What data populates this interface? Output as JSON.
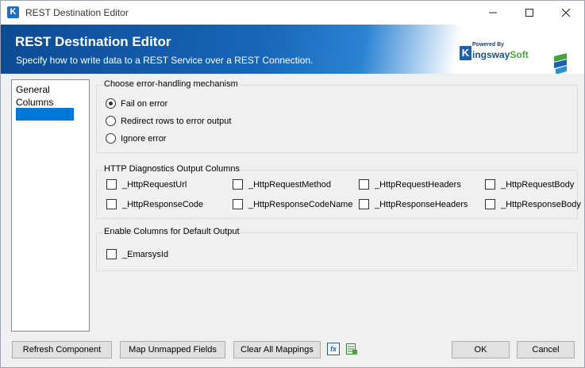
{
  "window": {
    "title": "REST Destination Editor",
    "app_icon_glyph": "K",
    "controls": [
      "minimize-icon",
      "maximize-icon",
      "close-icon"
    ]
  },
  "banner": {
    "title": "REST Destination Editor",
    "subtitle": "Specify how to write data to a REST Service over a REST Connection.",
    "brand_powered": "Powered By",
    "brand_k": "K",
    "brand_name": "ingsway",
    "brand_soft": "Soft"
  },
  "nav": {
    "items": [
      {
        "label": "General",
        "selected": false
      },
      {
        "label": "Columns",
        "selected": false
      },
      {
        "label": "",
        "selected": true
      }
    ]
  },
  "error_handling": {
    "label": "Choose error-handling mechanism",
    "options": [
      {
        "label": "Fail on error",
        "selected": true
      },
      {
        "label": "Redirect rows to error output",
        "selected": false
      },
      {
        "label": "Ignore error",
        "selected": false
      }
    ]
  },
  "diagnostics": {
    "label": "HTTP Diagnostics Output Columns",
    "columns": [
      {
        "label": "_HttpRequestUrl",
        "checked": false
      },
      {
        "label": "_HttpRequestMethod",
        "checked": false
      },
      {
        "label": "_HttpRequestHeaders",
        "checked": false
      },
      {
        "label": "_HttpRequestBody",
        "checked": false
      },
      {
        "label": "_HttpResponseCode",
        "checked": false
      },
      {
        "label": "_HttpResponseCodeName",
        "checked": false
      },
      {
        "label": "_HttpResponseHeaders",
        "checked": false
      },
      {
        "label": "_HttpResponseBody",
        "checked": false
      }
    ]
  },
  "default_output": {
    "label": "Enable Columns for Default Output",
    "columns": [
      {
        "label": "_EmarsysId",
        "checked": false
      }
    ]
  },
  "footer": {
    "refresh": "Refresh Component",
    "map_unmapped": "Map Unmapped Fields",
    "clear_mappings": "Clear All Mappings",
    "fx_icon": "fx",
    "ok": "OK",
    "cancel": "Cancel"
  },
  "colors": {
    "selection": "#0078d7",
    "banner_dark": "#0d4a94",
    "brand_green": "#48a23f"
  }
}
